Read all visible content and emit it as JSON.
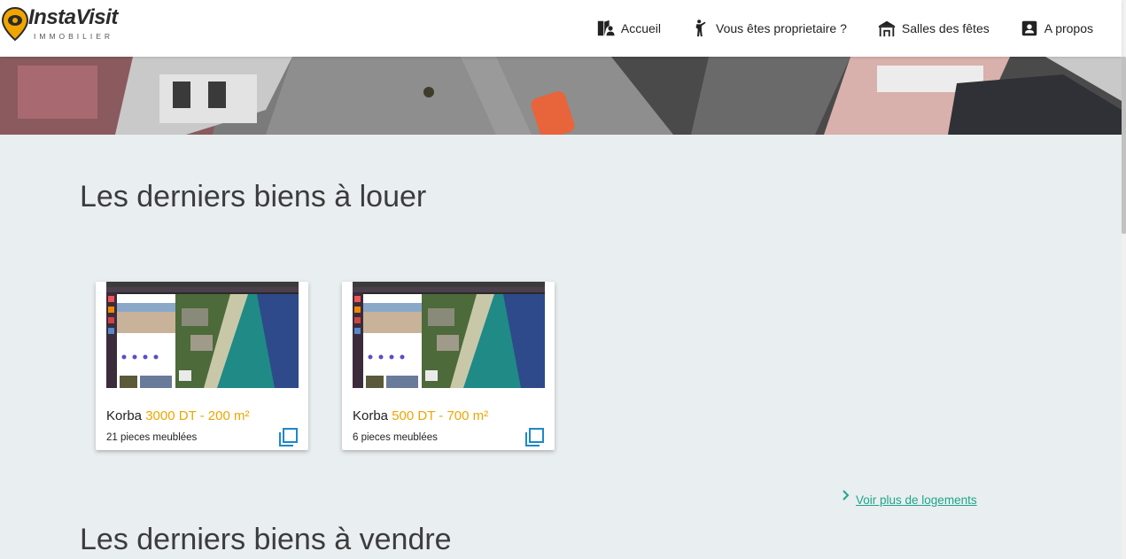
{
  "logo": {
    "name": "InstaVisit",
    "sub": "IMMOBILIER"
  },
  "nav": [
    {
      "label": "Accueil",
      "icon": "map-person-icon"
    },
    {
      "label": "Vous êtes proprietaire ?",
      "icon": "person-pointing-icon"
    },
    {
      "label": "Salles des fêtes",
      "icon": "hall-icon"
    },
    {
      "label": "A propos",
      "icon": "contact-card-icon"
    }
  ],
  "rent_section": {
    "title": "Les derniers biens à louer",
    "cards": [
      {
        "city": "Korba",
        "price": "3000 DT - 200 m²",
        "details": "21 pieces meublées"
      },
      {
        "city": "Korba",
        "price": "500 DT - 700 m²",
        "details": "6 pieces meublées"
      }
    ],
    "more_link": " Voir plus de logements"
  },
  "sale_section": {
    "title": "Les derniers biens à vendre"
  },
  "colors": {
    "accent_price": "#f0a500",
    "link": "#1fa58a",
    "copy_icon": "#1e88c8",
    "background": "#e9eef0"
  }
}
